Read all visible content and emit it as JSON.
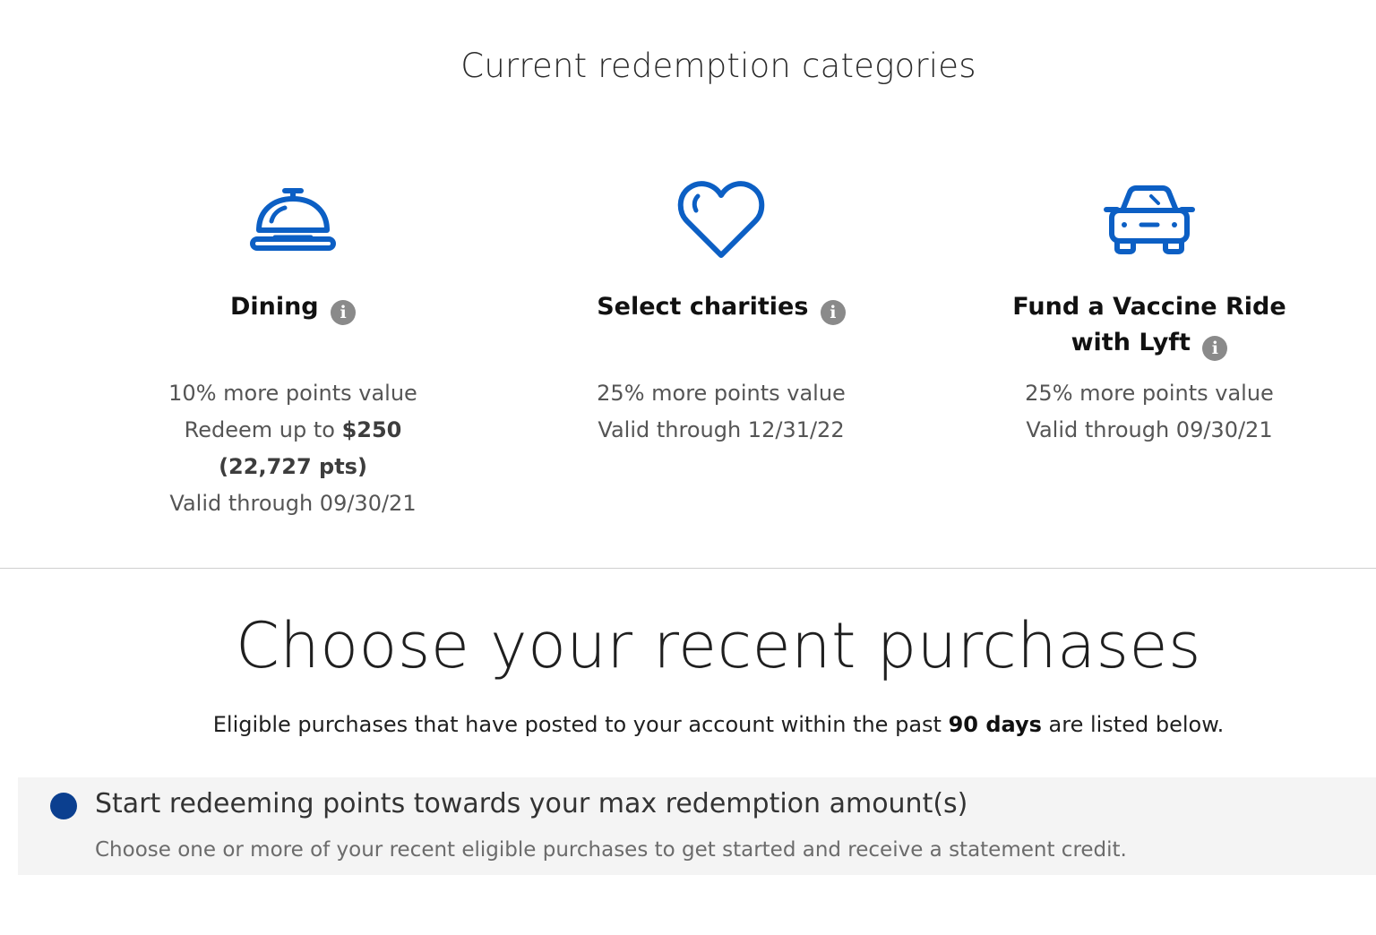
{
  "section_title": "Current redemption categories",
  "categories": [
    {
      "icon": "service-bell-icon",
      "title": "Dining",
      "details": {
        "line1": "10% more points value",
        "line2_prefix": "Redeem up to ",
        "line2_amount": "$250",
        "line3": "(22,727 pts)",
        "line4": "Valid through 09/30/21"
      }
    },
    {
      "icon": "heart-icon",
      "title": "Select charities",
      "details": {
        "line1": "25% more points value",
        "line2": "Valid through 12/31/22"
      }
    },
    {
      "icon": "car-icon",
      "title_line1": "Fund a Vaccine Ride",
      "title_line2": "with Lyft",
      "details": {
        "line1": "25% more points value",
        "line2": "Valid through 09/30/21"
      }
    }
  ],
  "info_glyph": "i",
  "main_title": "Choose your recent purchases",
  "subtitle": {
    "prefix": "Eligible purchases that have posted to your account within the past ",
    "bold": "90 days",
    "suffix": " are listed below."
  },
  "banner": {
    "heading": "Start redeeming points towards your max redemption amount(s)",
    "text": "Choose one or more of your recent eligible purchases to get started and receive a statement credit."
  },
  "colors": {
    "icon_blue": "#0c5fc4",
    "dot_blue": "#0b3f8f",
    "banner_bg": "#f4f4f4"
  }
}
